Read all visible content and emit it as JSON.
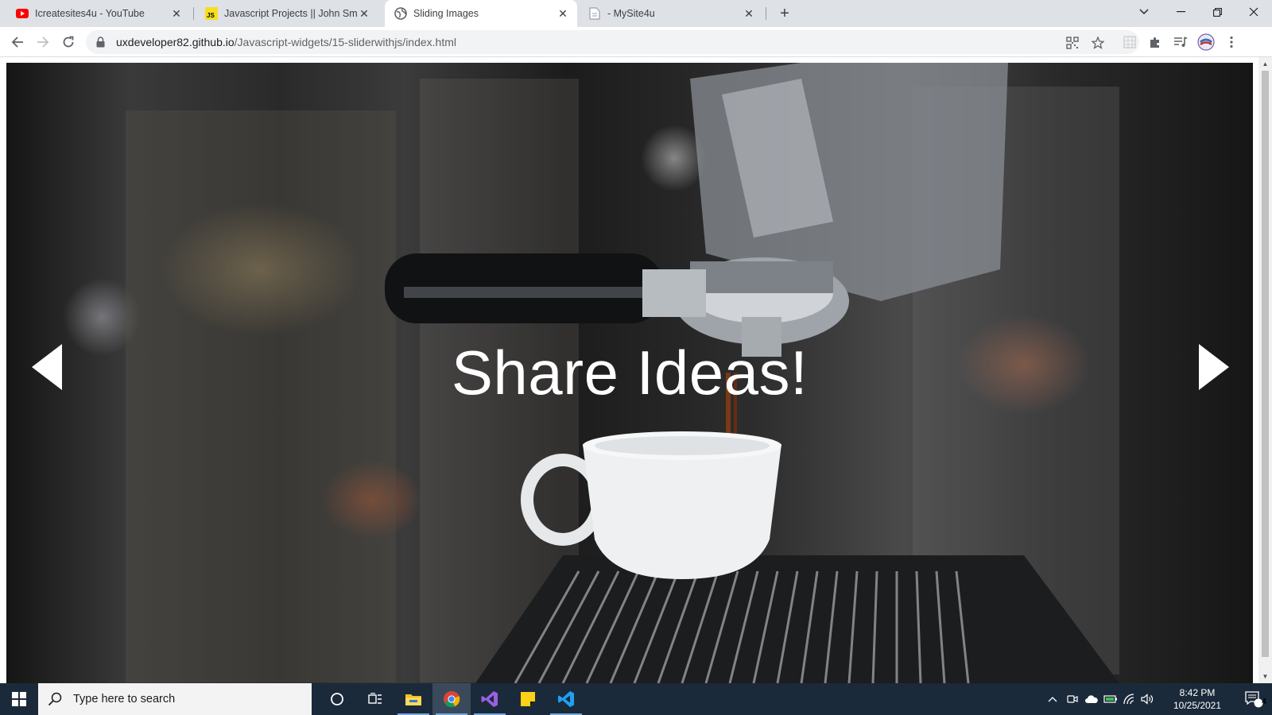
{
  "browser": {
    "tabs": [
      {
        "title": "Icreatesites4u - YouTube",
        "favicon": "youtube-icon"
      },
      {
        "title": "Javascript Projects || John Smilga",
        "favicon": "js-icon",
        "favicon_text": "JS"
      },
      {
        "title": "Sliding Images",
        "favicon": "globe-icon",
        "active": true
      },
      {
        "title": "- MySite4u",
        "favicon": "page-icon"
      }
    ],
    "url_host": "uxdeveloper82.github.io",
    "url_path": "/Javascript-widgets/15-sliderwithjs/index.html"
  },
  "slider": {
    "caption": "Share Ideas!",
    "prev_icon": "triangle-left-icon",
    "next_icon": "triangle-right-icon"
  },
  "taskbar": {
    "search_placeholder": "Type here to search",
    "time": "8:42 PM",
    "date": "10/25/2021",
    "notification_count": "4"
  },
  "colors": {
    "tabstrip": "#dee1e6",
    "taskbar": "#1b2a3a",
    "youtube_red": "#ff0000",
    "js_yellow": "#f7df1e"
  }
}
